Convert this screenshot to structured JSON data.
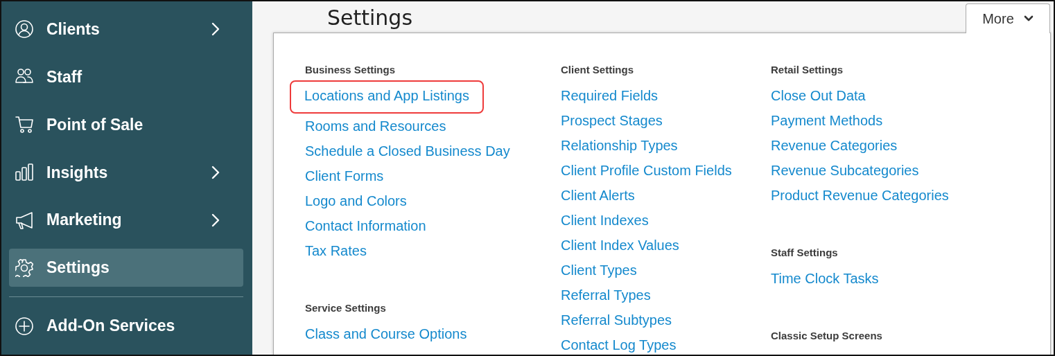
{
  "sidebar": {
    "items": [
      {
        "label": "Clients",
        "has_submenu": true,
        "selected": false
      },
      {
        "label": "Staff",
        "has_submenu": false,
        "selected": false
      },
      {
        "label": "Point of Sale",
        "has_submenu": false,
        "selected": false
      },
      {
        "label": "Insights",
        "has_submenu": true,
        "selected": false
      },
      {
        "label": "Marketing",
        "has_submenu": true,
        "selected": false
      },
      {
        "label": "Settings",
        "has_submenu": false,
        "selected": true
      },
      {
        "label": "Add-On Services",
        "has_submenu": false,
        "selected": false,
        "divider_before": true
      }
    ]
  },
  "page": {
    "title": "Settings"
  },
  "more_tab": {
    "label": "More",
    "expanded": true
  },
  "menu": {
    "columns": [
      {
        "sections": [
          {
            "heading": "Business Settings",
            "links": [
              {
                "label": "Locations and App Listings",
                "highlighted": true
              },
              {
                "label": "Rooms and Resources",
                "highlighted": false
              },
              {
                "label": "Schedule a Closed Business Day",
                "highlighted": false
              },
              {
                "label": "Client Forms",
                "highlighted": false
              },
              {
                "label": "Logo and Colors",
                "highlighted": false
              },
              {
                "label": "Contact Information",
                "highlighted": false
              },
              {
                "label": "Tax Rates",
                "highlighted": false
              }
            ]
          },
          {
            "heading": "Service Settings",
            "links": [
              {
                "label": "Class and Course Options",
                "highlighted": false
              }
            ]
          }
        ]
      },
      {
        "sections": [
          {
            "heading": "Client Settings",
            "links": [
              {
                "label": "Required Fields",
                "highlighted": false
              },
              {
                "label": "Prospect Stages",
                "highlighted": false
              },
              {
                "label": "Relationship Types",
                "highlighted": false
              },
              {
                "label": "Client Profile Custom Fields",
                "highlighted": false
              },
              {
                "label": "Client Alerts",
                "highlighted": false
              },
              {
                "label": "Client Indexes",
                "highlighted": false
              },
              {
                "label": "Client Index Values",
                "highlighted": false
              },
              {
                "label": "Client Types",
                "highlighted": false
              },
              {
                "label": "Referral Types",
                "highlighted": false
              },
              {
                "label": "Referral Subtypes",
                "highlighted": false
              },
              {
                "label": "Contact Log Types",
                "highlighted": false
              }
            ]
          }
        ]
      },
      {
        "sections": [
          {
            "heading": "Retail Settings",
            "links": [
              {
                "label": "Close Out Data",
                "highlighted": false
              },
              {
                "label": "Payment Methods",
                "highlighted": false
              },
              {
                "label": "Revenue Categories",
                "highlighted": false
              },
              {
                "label": "Revenue Subcategories",
                "highlighted": false
              },
              {
                "label": "Product Revenue Categories",
                "highlighted": false
              }
            ]
          },
          {
            "heading": "Staff Settings",
            "links": [
              {
                "label": "Time Clock Tasks",
                "highlighted": false
              }
            ]
          },
          {
            "heading": "Classic Setup Screens"
          }
        ]
      }
    ]
  }
}
